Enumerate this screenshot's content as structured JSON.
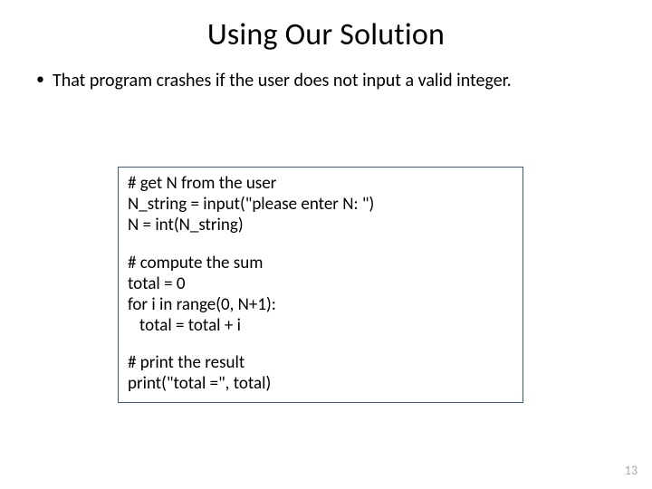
{
  "title": "Using Our Solution",
  "bullet1": "That program crashes if the user does not input a valid integer.",
  "code": {
    "b1l1": "# get N from the user",
    "b1l2": "N_string = input(\"please enter N: \")",
    "b1l3": "N = int(N_string)",
    "b2l1": "# compute the sum",
    "b2l2": "total = 0",
    "b2l3": "for i in range(0, N+1):",
    "b2l4": "   total = total + i",
    "b3l1": "# print the result",
    "b3l2": "print(\"total =\", total)"
  },
  "page_number": "13"
}
